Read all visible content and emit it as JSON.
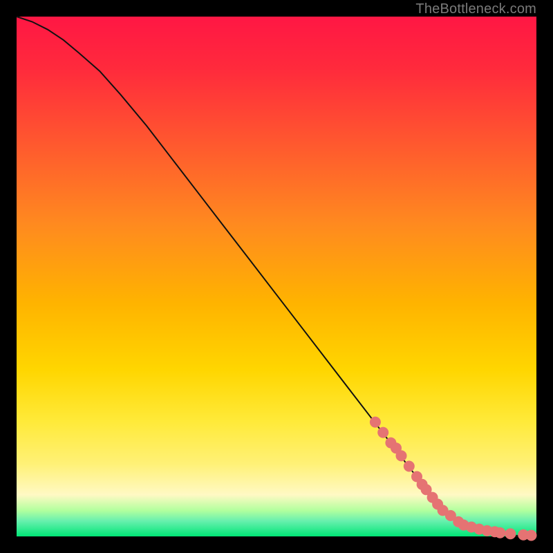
{
  "attribution": "TheBottleneck.com",
  "colors": {
    "frame": "#000000",
    "curve": "#111111",
    "dot": "#e57373",
    "gradient_stops": [
      "#ff1744",
      "#ff2a3c",
      "#ff5a2e",
      "#ff8a1f",
      "#ffb300",
      "#ffd600",
      "#ffea3a",
      "#fff176",
      "#fff9c4",
      "#b2ff9e",
      "#69f0ae",
      "#00e676"
    ]
  },
  "chart_data": {
    "type": "line",
    "title": "",
    "xlabel": "",
    "ylabel": "",
    "xlim": [
      0,
      100
    ],
    "ylim": [
      0,
      100
    ],
    "grid": false,
    "series": [
      {
        "name": "curve",
        "x": [
          0,
          3,
          6,
          9,
          12,
          16,
          20,
          25,
          30,
          35,
          40,
          45,
          50,
          55,
          60,
          65,
          70,
          75,
          80,
          83,
          86,
          90,
          95,
          100
        ],
        "y": [
          100,
          99,
          97.5,
          95.5,
          93,
          89.5,
          85,
          79,
          72.5,
          66,
          59.5,
          53,
          46.5,
          40,
          33.5,
          27,
          20.5,
          14,
          7.5,
          4.5,
          2.2,
          0.8,
          0.2,
          0
        ]
      }
    ],
    "highlight_points": {
      "name": "dots",
      "x": [
        69,
        70.5,
        72,
        73,
        74,
        75.5,
        77,
        78,
        78.8,
        80,
        81,
        82,
        83.5,
        85,
        86,
        87.5,
        89,
        90.5,
        92,
        93,
        95,
        97.5,
        99
      ],
      "y": [
        22,
        20,
        18,
        17,
        15.5,
        13.5,
        11.5,
        10,
        9,
        7.5,
        6.2,
        5,
        4,
        2.8,
        2.2,
        1.8,
        1.4,
        1.1,
        0.9,
        0.7,
        0.5,
        0.3,
        0.2
      ]
    }
  }
}
